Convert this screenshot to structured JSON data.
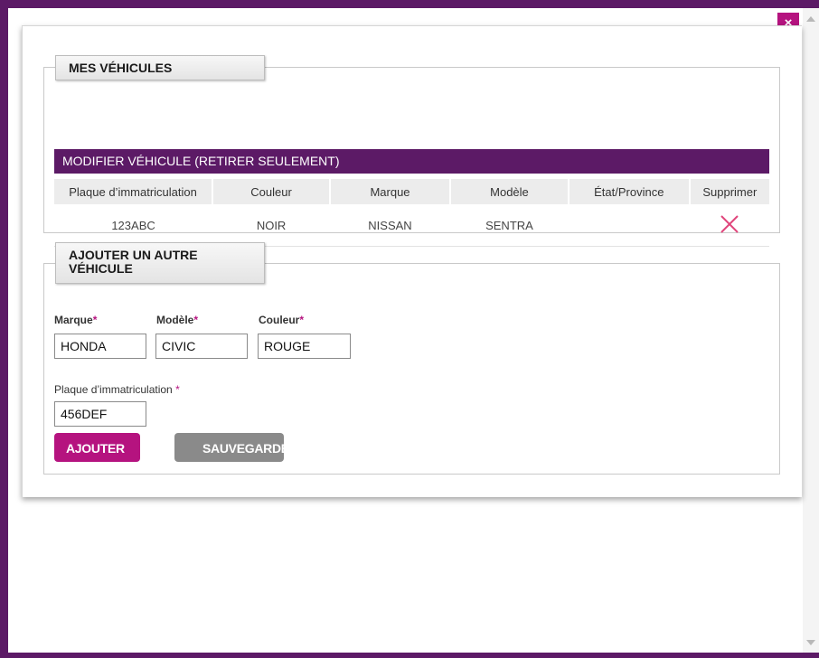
{
  "window": {
    "close_label": "×"
  },
  "my_vehicles": {
    "legend": "MES VÉHICULES",
    "section_title": "MODIFIER VÉHICULE (RETIRER SEULEMENT)",
    "columns": [
      "Plaque d’immatriculation",
      "Couleur",
      "Marque",
      "Modèle",
      "État/Province",
      "Supprimer"
    ],
    "rows": [
      {
        "plate": "123ABC",
        "color": "NOIR",
        "make": "NISSAN",
        "model": "SENTRA",
        "province": "",
        "delete_icon": "close-x-icon"
      }
    ]
  },
  "add_vehicle": {
    "legend_line1": "AJOUTER UN AUTRE",
    "legend_line2": "VÉHICULE",
    "make_label": "Marque",
    "model_label": "Modèle",
    "color_label": "Couleur",
    "plate_label": "Plaque d’immatriculation ",
    "required_mark": "*",
    "make_value": "HONDA",
    "model_value": "CIVIC",
    "color_value": "ROUGE",
    "plate_value": "456DEF",
    "add_button": "AJOUTER",
    "save_button": "SAUVEGARDER"
  },
  "colors": {
    "frame": "#5c1a66",
    "accent": "#b5137f",
    "save_button": "#8a8a8a"
  }
}
